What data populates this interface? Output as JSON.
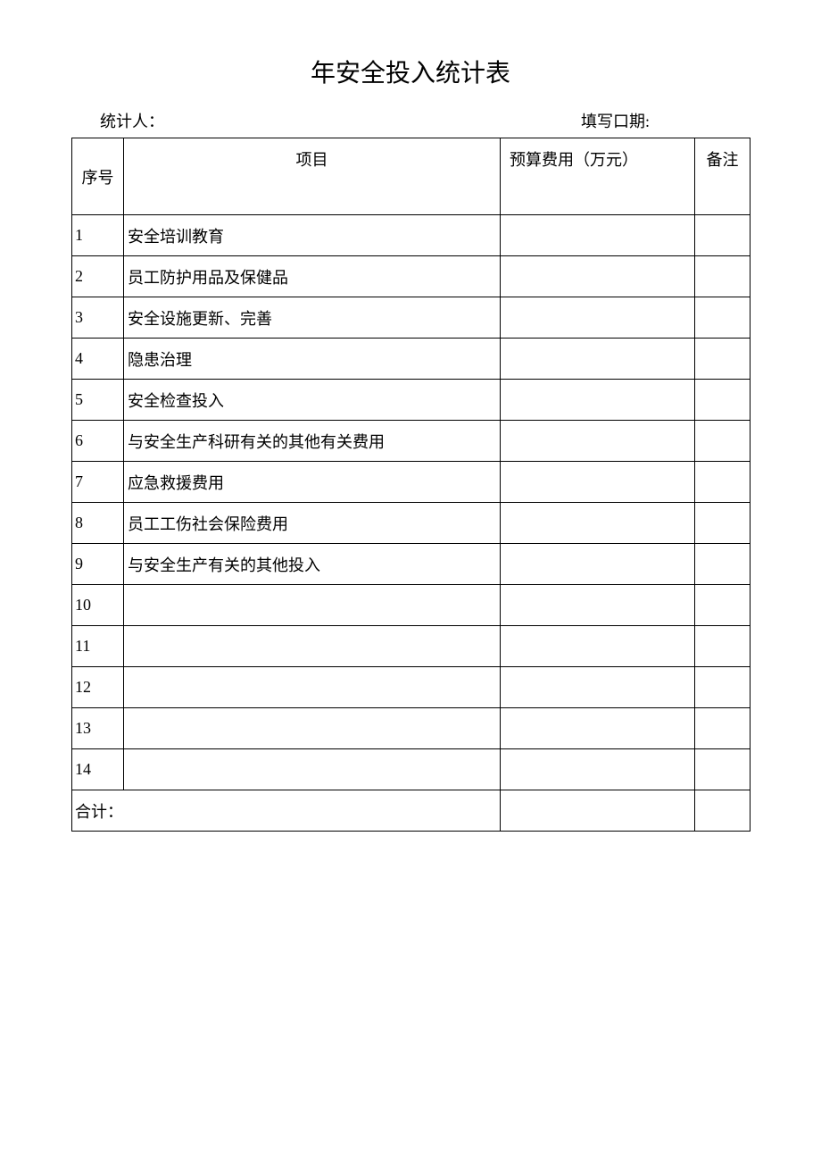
{
  "title": "年安全投入统计表",
  "meta": {
    "recorder_label": "统计人：",
    "date_label": "填写口期:"
  },
  "headers": {
    "seq": "序号",
    "item": "项目",
    "cost": "预算费用（万元）",
    "note": "备注"
  },
  "rows": [
    {
      "seq": "1",
      "item": "安全培训教育",
      "cost": "",
      "note": ""
    },
    {
      "seq": "2",
      "item": "员工防护用品及保健品",
      "cost": "",
      "note": ""
    },
    {
      "seq": "3",
      "item": "安全设施更新、完善",
      "cost": "",
      "note": ""
    },
    {
      "seq": "4",
      "item": "隐患治理",
      "cost": "",
      "note": ""
    },
    {
      "seq": "5",
      "item": "安全检查投入",
      "cost": "",
      "note": ""
    },
    {
      "seq": "6",
      "item": "与安全生产科研有关的其他有关费用",
      "cost": "",
      "note": ""
    },
    {
      "seq": "7",
      "item": "应急救援费用",
      "cost": "",
      "note": ""
    },
    {
      "seq": "8",
      "item": "员工工伤社会保险费用",
      "cost": "",
      "note": ""
    },
    {
      "seq": "9",
      "item": "与安全生产有关的其他投入",
      "cost": "",
      "note": ""
    },
    {
      "seq": "10",
      "item": "",
      "cost": "",
      "note": ""
    },
    {
      "seq": "11",
      "item": "",
      "cost": "",
      "note": ""
    },
    {
      "seq": "12",
      "item": "",
      "cost": "",
      "note": ""
    },
    {
      "seq": "13",
      "item": "",
      "cost": "",
      "note": ""
    },
    {
      "seq": "14",
      "item": "",
      "cost": "",
      "note": ""
    }
  ],
  "total": {
    "label": "合计：",
    "cost": "",
    "note": ""
  }
}
